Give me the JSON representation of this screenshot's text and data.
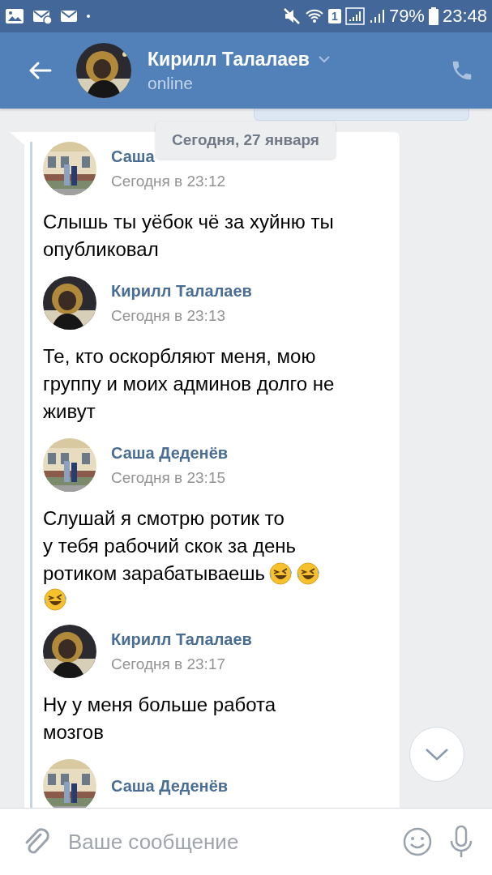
{
  "status_bar": {
    "sim": "1",
    "battery": "79%",
    "time": "23:48"
  },
  "header": {
    "name": "Кирилл Талалаев",
    "status": "online"
  },
  "date_divider": "Сегодня, 27 января",
  "messages": [
    {
      "author": "Саша",
      "time": "Сегодня в 23:12",
      "lines": [
        [
          {
            "kind": "text",
            "text": "Слышь ты уёбок чё за хуйню ты"
          }
        ],
        [
          {
            "kind": "text",
            "text": "опубликовал"
          }
        ]
      ]
    },
    {
      "author": "Кирилл Талалаев",
      "time": "Сегодня в 23:13",
      "lines": [
        [
          {
            "kind": "text",
            "text": "Те, кто оскорбляют меня, мою"
          }
        ],
        [
          {
            "kind": "text",
            "text": "группу и моих админов долго не"
          }
        ],
        [
          {
            "kind": "text",
            "text": "живут"
          }
        ]
      ]
    },
    {
      "author": "Саша Деденёв",
      "time": "Сегодня в 23:15",
      "lines": [
        [
          {
            "kind": "text",
            "text": "Слушай я смотрю ротик то"
          }
        ],
        [
          {
            "kind": "text",
            "text": "у тебя рабочий скок за день"
          }
        ],
        [
          {
            "kind": "text",
            "text": "ротиком зарабатываешь"
          },
          {
            "kind": "emoji"
          },
          {
            "kind": "emoji"
          }
        ],
        [
          {
            "kind": "emoji"
          }
        ]
      ]
    },
    {
      "author": "Кирилл Талалаев",
      "time": "Сегодня в 23:17",
      "lines": [
        [
          {
            "kind": "text",
            "text": "Ну у меня больше работа"
          }
        ],
        [
          {
            "kind": "text",
            "text": "мозгов"
          }
        ]
      ]
    },
    {
      "author": "Саша Деденёв"
    }
  ],
  "composer": {
    "placeholder": "Ваше сообщение"
  }
}
